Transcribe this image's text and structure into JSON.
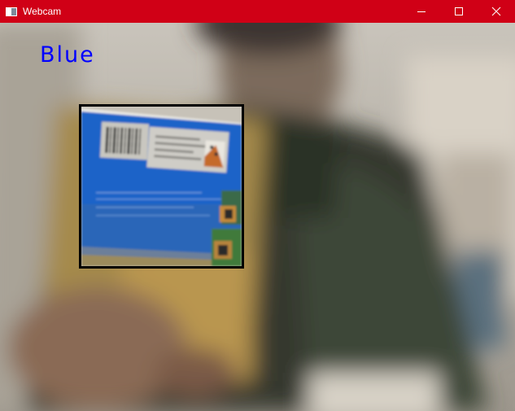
{
  "window": {
    "title": "Webcam",
    "app_icon": "window-app-icon",
    "controls": {
      "minimize_icon": "minimize-icon",
      "maximize_icon": "maximize-icon",
      "close_icon": "close-icon"
    },
    "titlebar_color": "#d00016"
  },
  "camera": {
    "detected_color_label": "Blue",
    "label_color": "#0000ff",
    "detection_box_color": "#000000"
  }
}
